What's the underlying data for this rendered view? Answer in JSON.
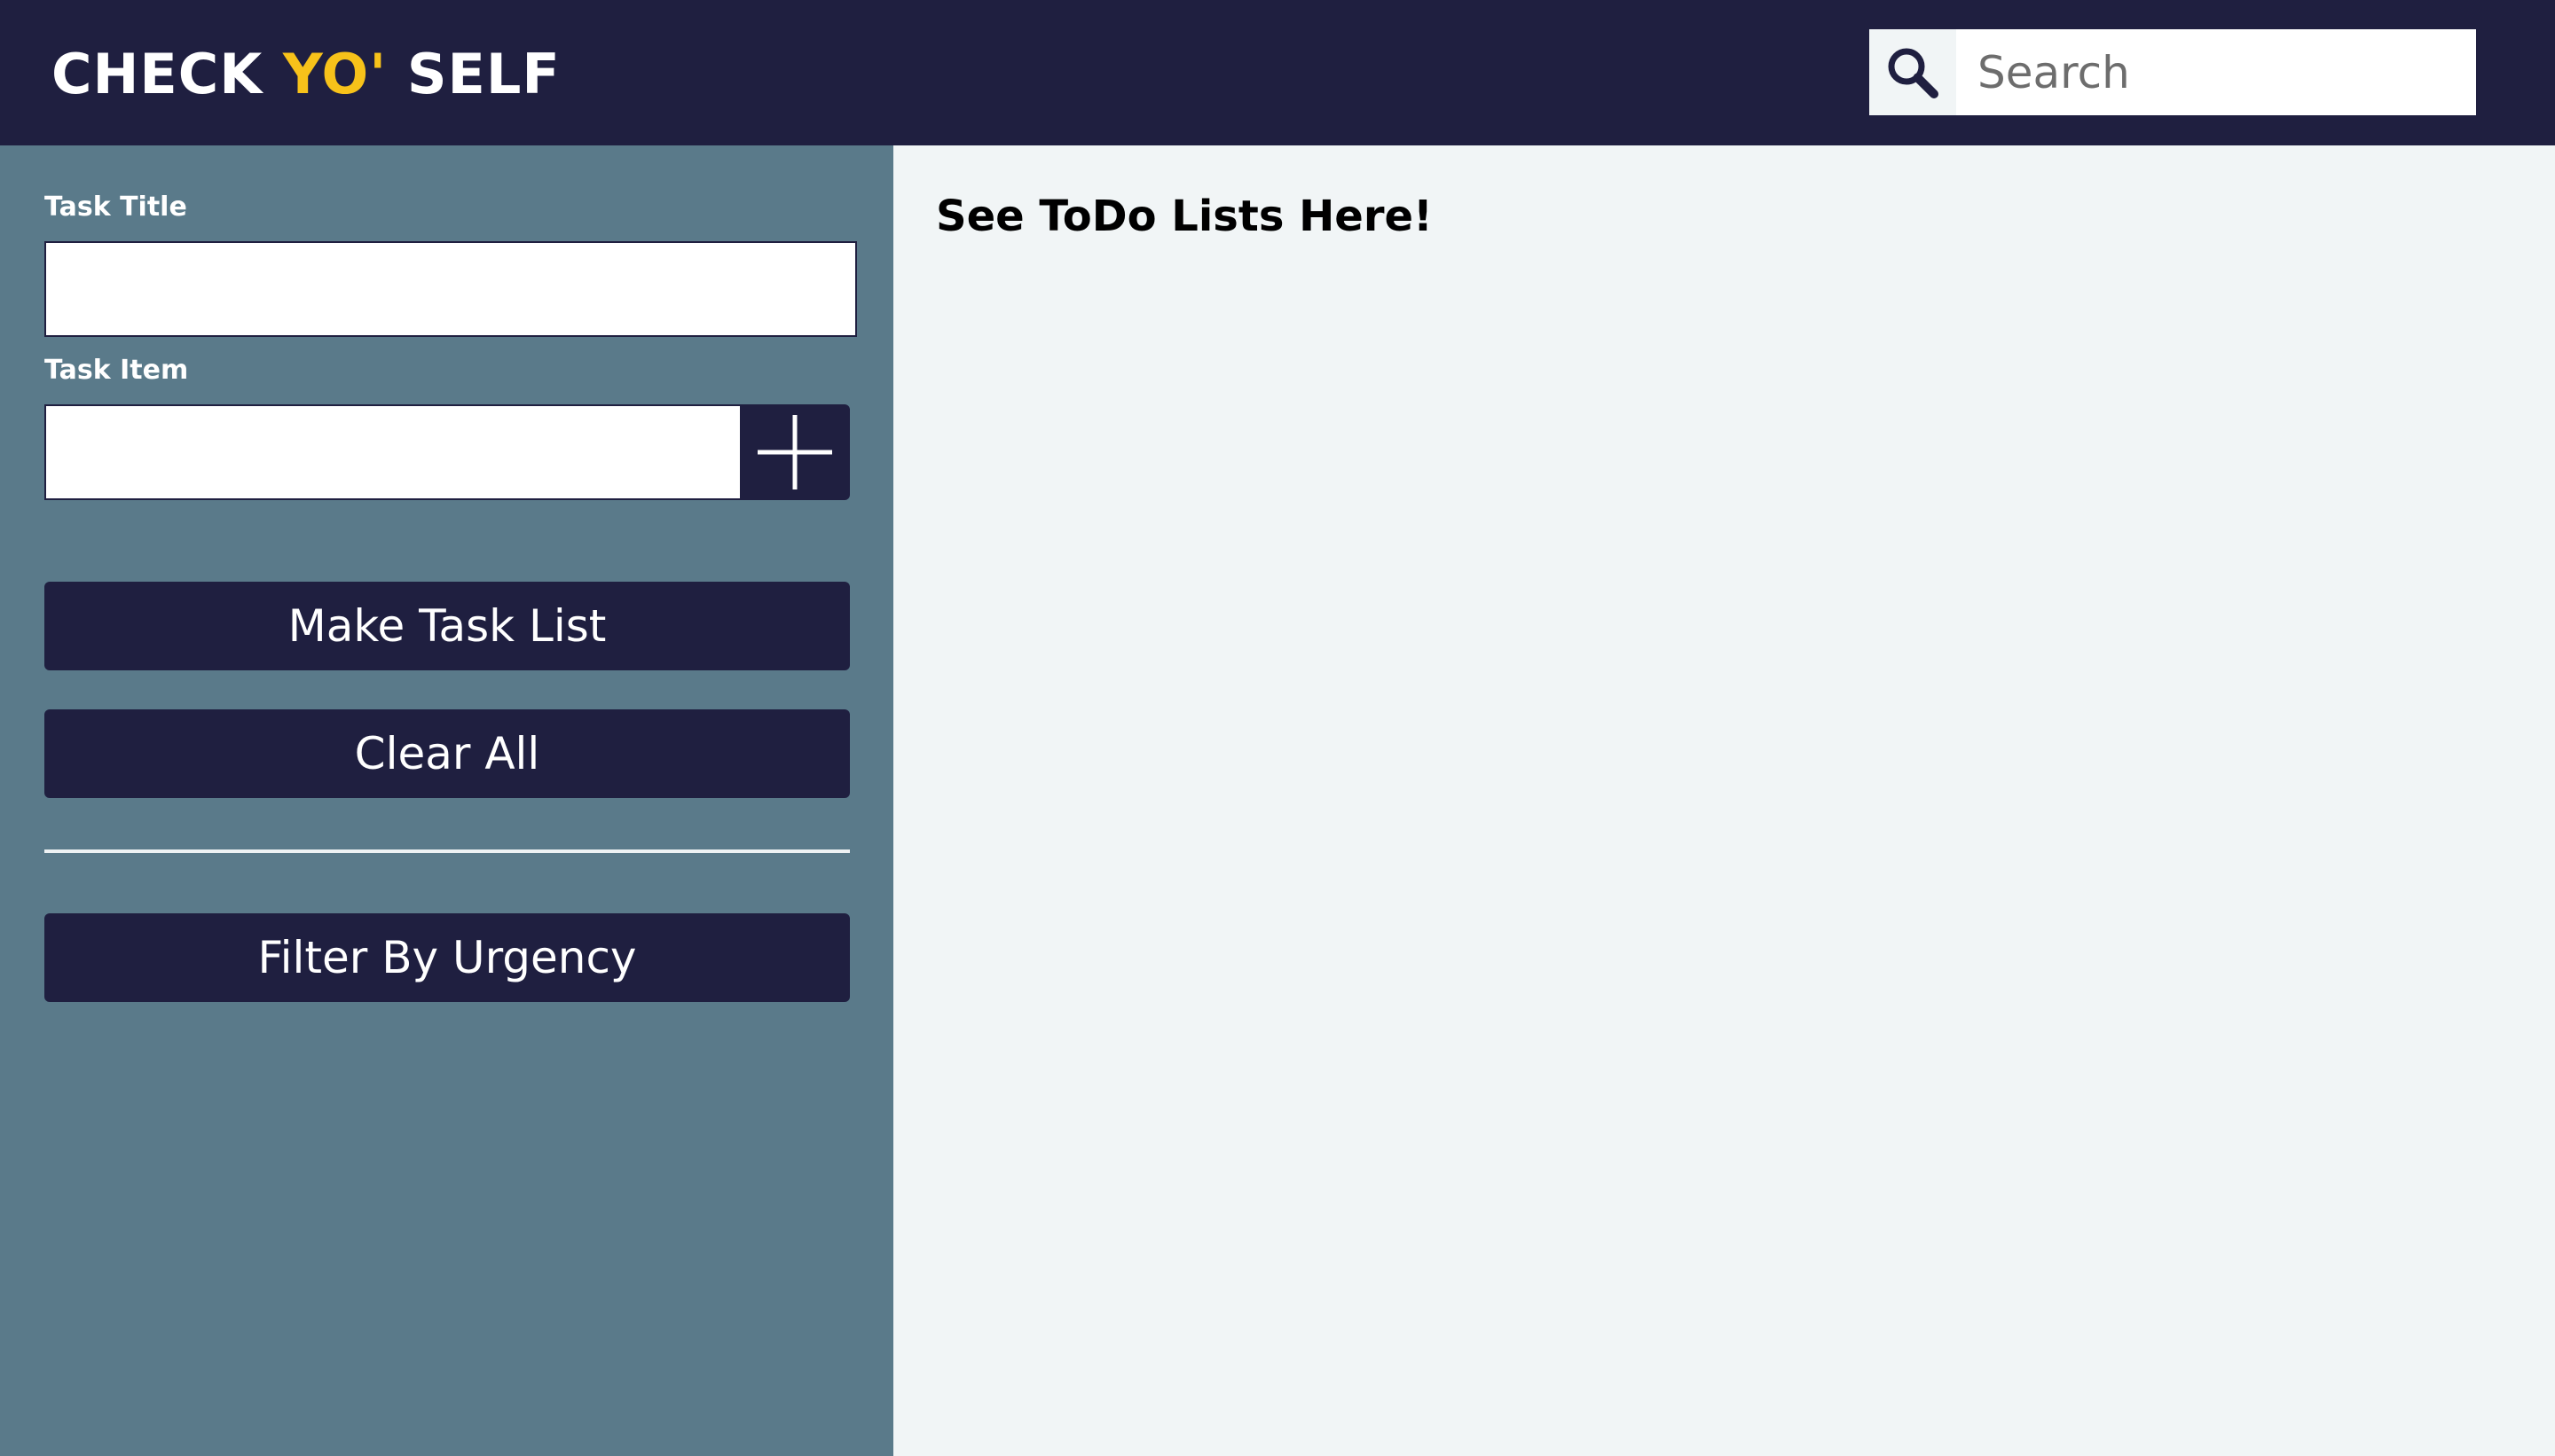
{
  "header": {
    "logo": {
      "part1": "CHECK ",
      "accent": "YO'",
      "part2": " SELF"
    },
    "search": {
      "icon": "search-icon",
      "placeholder": "Search"
    }
  },
  "sidebar": {
    "task_title_label": "Task Title",
    "task_title_value": "",
    "task_item_label": "Task Item",
    "task_item_value": "",
    "add_item_icon": "plus-icon",
    "make_task_list_label": "Make Task List",
    "clear_all_label": "Clear All",
    "filter_by_urgency_label": "Filter By Urgency"
  },
  "main": {
    "heading": "See ToDo Lists Here!"
  },
  "colors": {
    "header_bg": "#1f1f40",
    "logo_accent": "#f7c21a",
    "sidebar_bg": "#5a7a8a",
    "button_bg": "#1f1f40",
    "main_bg": "#f1f5f6"
  }
}
